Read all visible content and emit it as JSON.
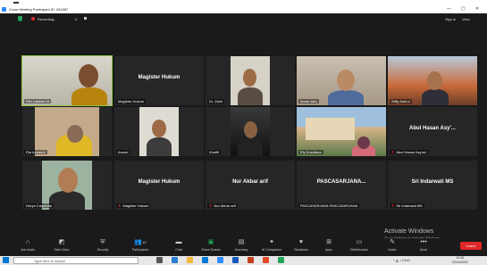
{
  "window": {
    "title": "Zoom Meeting Participant ID: 281687"
  },
  "recording": {
    "label": "Recording...",
    "pause": "II"
  },
  "topright": {
    "signin": "Sign in",
    "view": "View"
  },
  "tiles": [
    {
      "name": "Fitri Lahifah 34",
      "big": "",
      "active": true
    },
    {
      "name": "Magister Hukum",
      "big": "Magister Hukum"
    },
    {
      "name": "Dr. Zaini",
      "big": ""
    },
    {
      "name": "Imran Ilahi",
      "big": ""
    },
    {
      "name": "Willy Ashrul",
      "big": ""
    },
    {
      "name": "Ria Indraeni",
      "big": ""
    },
    {
      "name": "Ansori",
      "big": ""
    },
    {
      "name": "Khofifi",
      "big": ""
    },
    {
      "name": "Efy Kusdiana",
      "big": ""
    },
    {
      "name": "Abul Hasan Asy'ari",
      "big": "Abul Hasan Asy'..."
    },
    {
      "name": "Derys Carpentia",
      "big": ""
    },
    {
      "name": "Magister Hukum",
      "big": "Magister Hukum"
    },
    {
      "name": "Nur Akbar arif",
      "big": "Nur Akbar arif"
    },
    {
      "name": "PASCASARJANA PASCASARJANA",
      "big": "PASCASARJANA..."
    },
    {
      "name": "Sri Indarwati MS",
      "big": "Sri Indarwati MS"
    }
  ],
  "toolbar": {
    "items": [
      "Join Audio",
      "Start Video",
      "Security",
      "Participants",
      "Chat",
      "Share Screen",
      "Summary",
      "AI Companion",
      "Reactions",
      "Apps",
      "Whiteboards",
      "Notes",
      "More"
    ],
    "participants_count": "15",
    "leave": "Leave"
  },
  "watermark": {
    "title": "Activate Windows",
    "sub": "Go to Settings to activate Windows."
  },
  "taskbar": {
    "search_placeholder": "Type here to search",
    "lang": "ENG",
    "time": "10:26",
    "date": "22/10/2022"
  }
}
